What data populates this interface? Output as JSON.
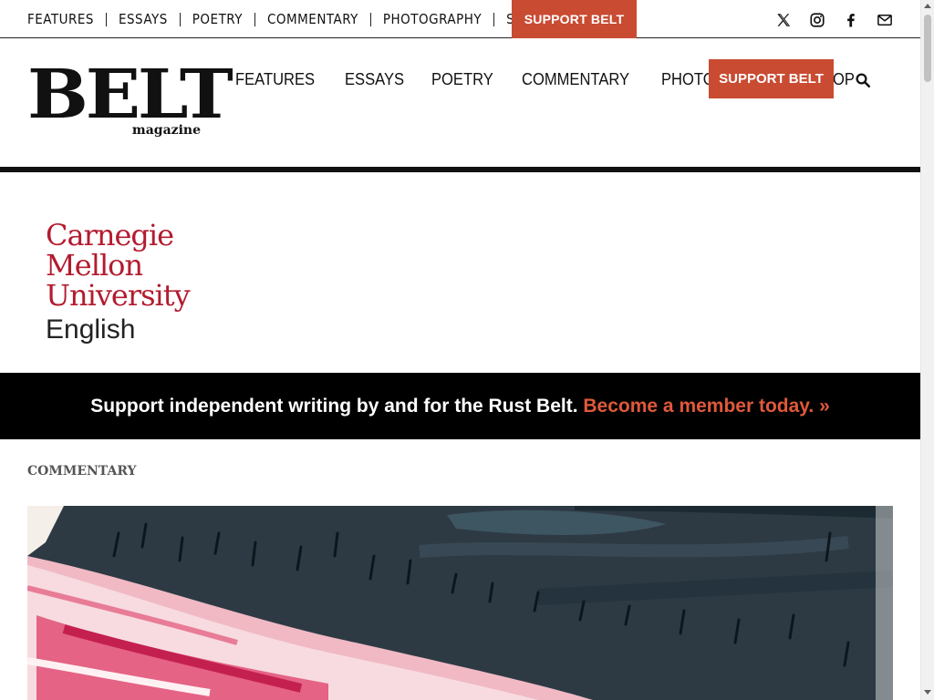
{
  "top_bar": {
    "nav": [
      "FEATURES",
      "ESSAYS",
      "POETRY",
      "COMMENTARY",
      "PHOTOGRAPHY",
      "SHOP"
    ],
    "support_label": "SUPPORT BELT",
    "social_icons": [
      "x-icon",
      "instagram-icon",
      "facebook-icon",
      "mail-icon"
    ]
  },
  "header": {
    "logo_main": "BELT",
    "logo_sub": "magazine",
    "nav": [
      "FEATURES",
      "ESSAYS",
      "POETRY",
      "COMMENTARY",
      "PHOTOGRAPHY",
      "SHOP"
    ],
    "support_label": "SUPPORT BELT"
  },
  "sponsor": {
    "line1": "Carnegie",
    "line2": "Mellon",
    "line3": "University",
    "line4": "English"
  },
  "banner": {
    "text": "Support independent writing by and for the Rust Belt.",
    "link": "Become a member today. »"
  },
  "article": {
    "category": "COMMENTARY"
  },
  "colors": {
    "accent": "#c94b32",
    "banner_link": "#e0593a",
    "cmu_red": "#b31b2f"
  }
}
